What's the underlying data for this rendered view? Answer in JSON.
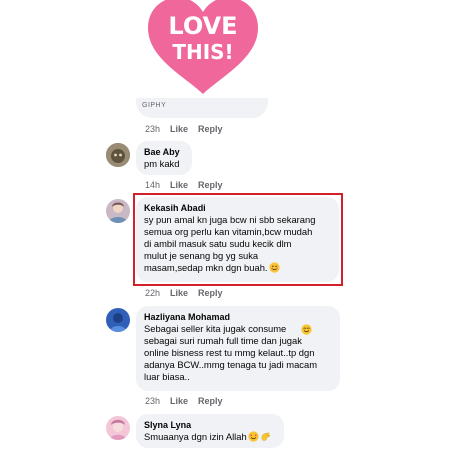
{
  "gif": {
    "heart_line1": "LOVE",
    "heart_line2": "THIS!",
    "source_label": "GIPHY",
    "time": "23h",
    "like_label": "Like",
    "reply_label": "Reply",
    "heart_color": "#f0689b"
  },
  "comments": [
    {
      "author": "Bae Aby",
      "text": "pm kakd",
      "time": "14h",
      "like_label": "Like",
      "reply_label": "Reply"
    },
    {
      "author": "Kekasih Abadi",
      "text": "sy pun amal kn juga bcw ni sbb sekarang\nsemua org perlu kan vitamin,bcw mudah\ndi ambil masuk satu sudu kecik dlm\nmulut  je senang bg yg suka\nmasam,sedap mkn dgn buah.",
      "time": "22h",
      "like_label": "Like",
      "reply_label": "Reply",
      "emoji": "smiling-face-emoji"
    },
    {
      "author": "Hazliyana Mohamad",
      "text": "Sebagai seller kita jugak consume\nsebagai suri rumah full time dan jugak\nonline bisness rest tu mmg kelaut..tp dgn\nadanya BCW..mmg tenaga tu jadi macam\nluar biasa..",
      "time": "23h",
      "like_label": "Like",
      "reply_label": "Reply",
      "emoji": "smiling-face-emoji"
    },
    {
      "author": "Slyna Lyna",
      "text": "Smuaanya dgn izin Allah",
      "time": "",
      "like_label": "",
      "reply_label": "",
      "emoji": "smiling-face-with-hearts-and-clapping-emoji"
    }
  ],
  "colors": {
    "bubble_bg": "#f0f2f5",
    "meta_text": "#65676b",
    "highlight_border": "#d3202a"
  }
}
